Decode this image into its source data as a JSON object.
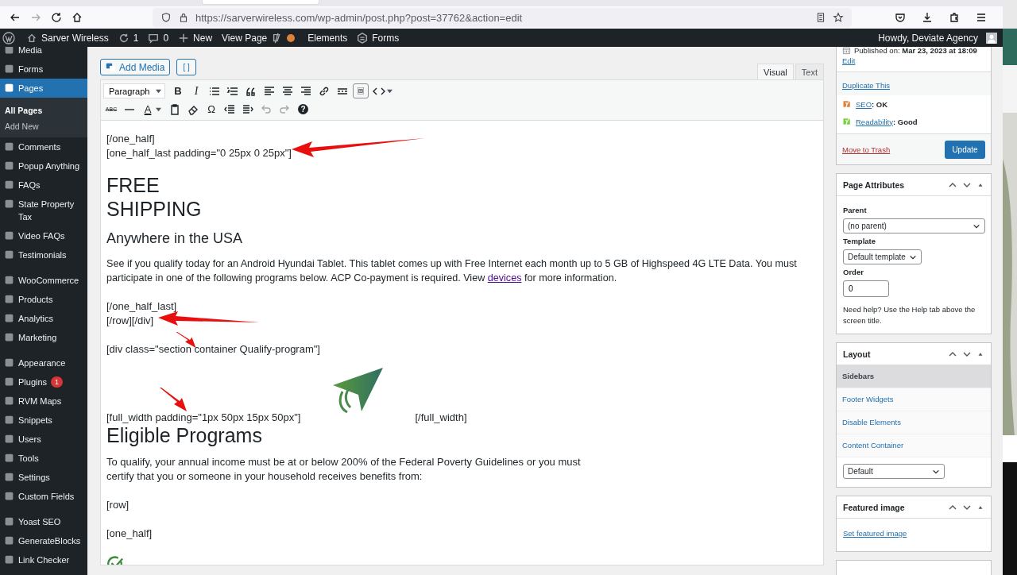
{
  "browser": {
    "url": "https://sarverwireless.com/wp-admin/post.php?post=37762&action=edit",
    "forward_disabled": true
  },
  "admin_bar": {
    "items": [
      {
        "kind": "site",
        "label": "Sarver Wireless"
      },
      {
        "kind": "updates",
        "label": "1"
      },
      {
        "kind": "comments",
        "label": "0"
      },
      {
        "kind": "new",
        "label": "New"
      },
      {
        "kind": "link",
        "label": "View Page"
      },
      {
        "kind": "yoast",
        "color": "#dd823b"
      },
      {
        "kind": "link",
        "label": "Elements"
      },
      {
        "kind": "forms",
        "label": "Forms"
      }
    ],
    "greeting": "Howdy, Deviate Agency"
  },
  "sidebar": {
    "groups": [
      {
        "items": [
          {
            "label": "Media",
            "selected": false
          },
          {
            "label": "Forms",
            "selected": false
          },
          {
            "label": "Pages",
            "selected": true,
            "children": [
              {
                "label": "All Pages",
                "selected": true
              },
              {
                "label": "Add New",
                "selected": false
              }
            ]
          },
          {
            "label": "Comments",
            "selected": false
          },
          {
            "label": "Popup Anything",
            "selected": false
          },
          {
            "label": "FAQs",
            "selected": false
          },
          {
            "label": "State Property Tax",
            "selected": false
          },
          {
            "label": "Video FAQs",
            "selected": false
          },
          {
            "label": "Testimonials",
            "selected": false
          }
        ]
      },
      {
        "items": [
          {
            "label": "WooCommerce",
            "selected": false
          },
          {
            "label": "Products",
            "selected": false
          },
          {
            "label": "Analytics",
            "selected": false
          },
          {
            "label": "Marketing",
            "selected": false
          }
        ]
      },
      {
        "items": [
          {
            "label": "Appearance",
            "selected": false
          },
          {
            "label": "Plugins",
            "selected": false,
            "badge": "1"
          },
          {
            "label": "RVM Maps",
            "selected": false
          },
          {
            "label": "Snippets",
            "selected": false
          },
          {
            "label": "Users",
            "selected": false
          },
          {
            "label": "Tools",
            "selected": false
          },
          {
            "label": "Settings",
            "selected": false
          },
          {
            "label": "Custom Fields",
            "selected": false
          }
        ]
      },
      {
        "items": [
          {
            "label": "Yoast SEO",
            "selected": false
          },
          {
            "label": "GenerateBlocks",
            "selected": false
          },
          {
            "label": "Link Checker",
            "selected": false
          }
        ]
      }
    ]
  },
  "editor": {
    "add_media": "Add Media",
    "shortcode_button": "[ ]",
    "tabs": [
      {
        "label": "Visual",
        "selected": true
      },
      {
        "label": "Text",
        "selected": false
      }
    ],
    "format": "Paragraph",
    "toolbar_rows": [
      [
        {
          "kind": "bold",
          "label": "B"
        },
        {
          "kind": "italic",
          "label": "I"
        },
        {
          "kind": "ul"
        },
        {
          "kind": "ol"
        },
        {
          "kind": "quote"
        },
        {
          "kind": "alignleft"
        },
        {
          "kind": "aligncenter"
        },
        {
          "kind": "alignright"
        },
        {
          "kind": "link"
        },
        {
          "kind": "more"
        },
        {
          "kind": "toggle",
          "selected": true
        },
        {
          "kind": "code",
          "dropdown": true
        }
      ],
      [
        {
          "kind": "strike",
          "label": "ABC"
        },
        {
          "kind": "hr"
        },
        {
          "kind": "color",
          "label": "A",
          "dropdown": true
        },
        {
          "kind": "paste"
        },
        {
          "kind": "eraser"
        },
        {
          "kind": "char",
          "label": "Ω"
        },
        {
          "kind": "outdent"
        },
        {
          "kind": "indent"
        },
        {
          "kind": "undo",
          "disabled": true
        },
        {
          "kind": "redo",
          "disabled": true
        },
        {
          "kind": "help",
          "label": "?"
        }
      ]
    ],
    "content": [
      {
        "kind": "code",
        "lines": [
          "[/one_half]",
          "[one_half_last padding=\"0 25px 0 25px\"]"
        ]
      },
      {
        "kind": "h1",
        "lines": [
          "FREE",
          "SHIPPING"
        ]
      },
      {
        "kind": "h2",
        "lines": [
          "Anywhere in the USA"
        ]
      },
      {
        "kind": "para",
        "before": "See if you qualify today for an Android Hyundai Tablet. This tablet comes up with Free Internet each month up to 5 GB of Highspeed 4G LTE Data. You must participate in one of the following programs below. ACP Co-payment is required. View ",
        "link": "devices",
        "after": " for more information."
      },
      {
        "kind": "code",
        "lines": [
          "[/one_half_last]",
          "[/row][/div]"
        ]
      },
      {
        "kind": "code",
        "lines": [
          "[div class=\"section container Qualify-program\"]"
        ]
      },
      {
        "kind": "logo_row",
        "before": "[full_width padding=\"1px 50px 15px 50px\"]",
        "after": "[/full_width]"
      },
      {
        "kind": "h1",
        "lines": [
          "Eligible Programs"
        ]
      },
      {
        "kind": "code",
        "lines": [
          "To qualify, your annual income must be at or below 200% of the Federal Poverty Guidelines or you must",
          "certify that you or someone in your household receives benefits from:"
        ]
      },
      {
        "kind": "code",
        "lines": [
          "[row]"
        ]
      },
      {
        "kind": "code",
        "lines": [
          "[one_half]"
        ]
      },
      {
        "kind": "check"
      }
    ]
  },
  "publish": {
    "published": "Published on: **Mar 23, 2023 at 18:09**",
    "edit": "Edit",
    "duplicate": "Duplicate This",
    "scores": [
      {
        "label": "SEO",
        "value": ": OK",
        "color": "#dd823b"
      },
      {
        "label": "Readability",
        "value": ": Good",
        "color": "#7ad03a"
      }
    ],
    "trash": "Move to Trash",
    "update": "Update"
  },
  "page_attributes": {
    "title": "Page Attributes",
    "parent_label": "Parent",
    "parent": "(no parent)",
    "template_label": "Template",
    "template": "Default template",
    "order_label": "Order",
    "order": "0",
    "help": "Need help? Use the Help tab above the screen title."
  },
  "layout": {
    "title": "Layout",
    "tabs": [
      {
        "label": "Sidebars",
        "selected": true
      },
      {
        "label": "Footer Widgets",
        "selected": false
      },
      {
        "label": "Disable Elements",
        "selected": false
      },
      {
        "label": "Content Container",
        "selected": false
      }
    ],
    "select": "Default"
  },
  "featured": {
    "title": "Featured image",
    "link": "Set featured image"
  }
}
